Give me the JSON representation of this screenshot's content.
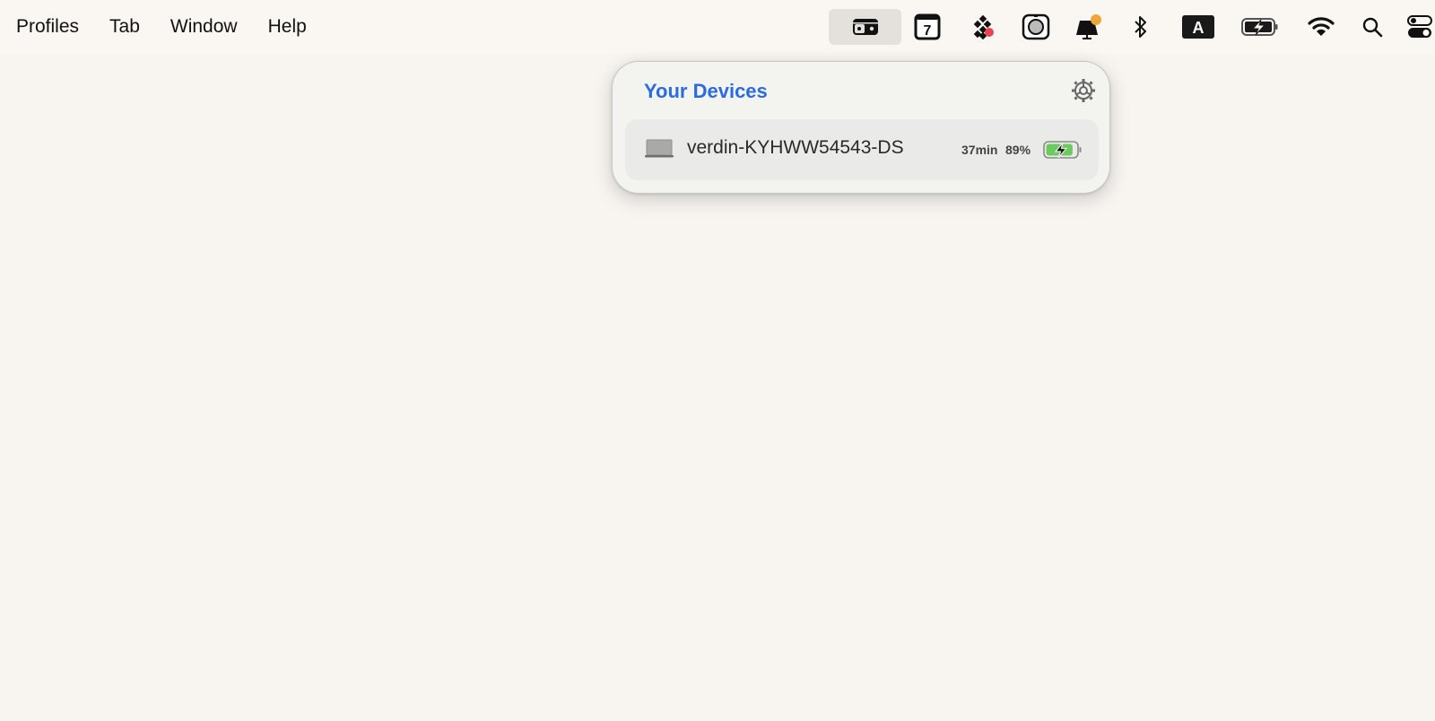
{
  "menubar": {
    "items": [
      {
        "label": "Profiles"
      },
      {
        "label": "Tab"
      },
      {
        "label": "Window"
      },
      {
        "label": "Help"
      }
    ],
    "status_icons": [
      {
        "name": "devices-menu-icon",
        "active": true
      },
      {
        "name": "calendar-icon",
        "text": "7"
      },
      {
        "name": "dots-app-icon",
        "badge_color": "#e8444f"
      },
      {
        "name": "camera-app-icon"
      },
      {
        "name": "notification-app-icon",
        "badge_color": "#f0a63a"
      },
      {
        "name": "bluetooth-icon"
      },
      {
        "name": "input-source-icon",
        "text": "A"
      },
      {
        "name": "battery-charging-icon"
      },
      {
        "name": "wifi-icon"
      },
      {
        "name": "spotlight-search-icon"
      },
      {
        "name": "control-center-icon"
      }
    ]
  },
  "popover": {
    "title": "Your Devices",
    "title_color": "#2a6ce0",
    "settings_icon": "gear-icon",
    "devices": [
      {
        "icon": "laptop-icon",
        "name": "verdin-KYHWW54543-DS",
        "time_remaining": "37min",
        "battery_percent": "89%",
        "battery_level": 0.89,
        "charging": true,
        "battery_color": "#6ccb5f"
      }
    ]
  }
}
